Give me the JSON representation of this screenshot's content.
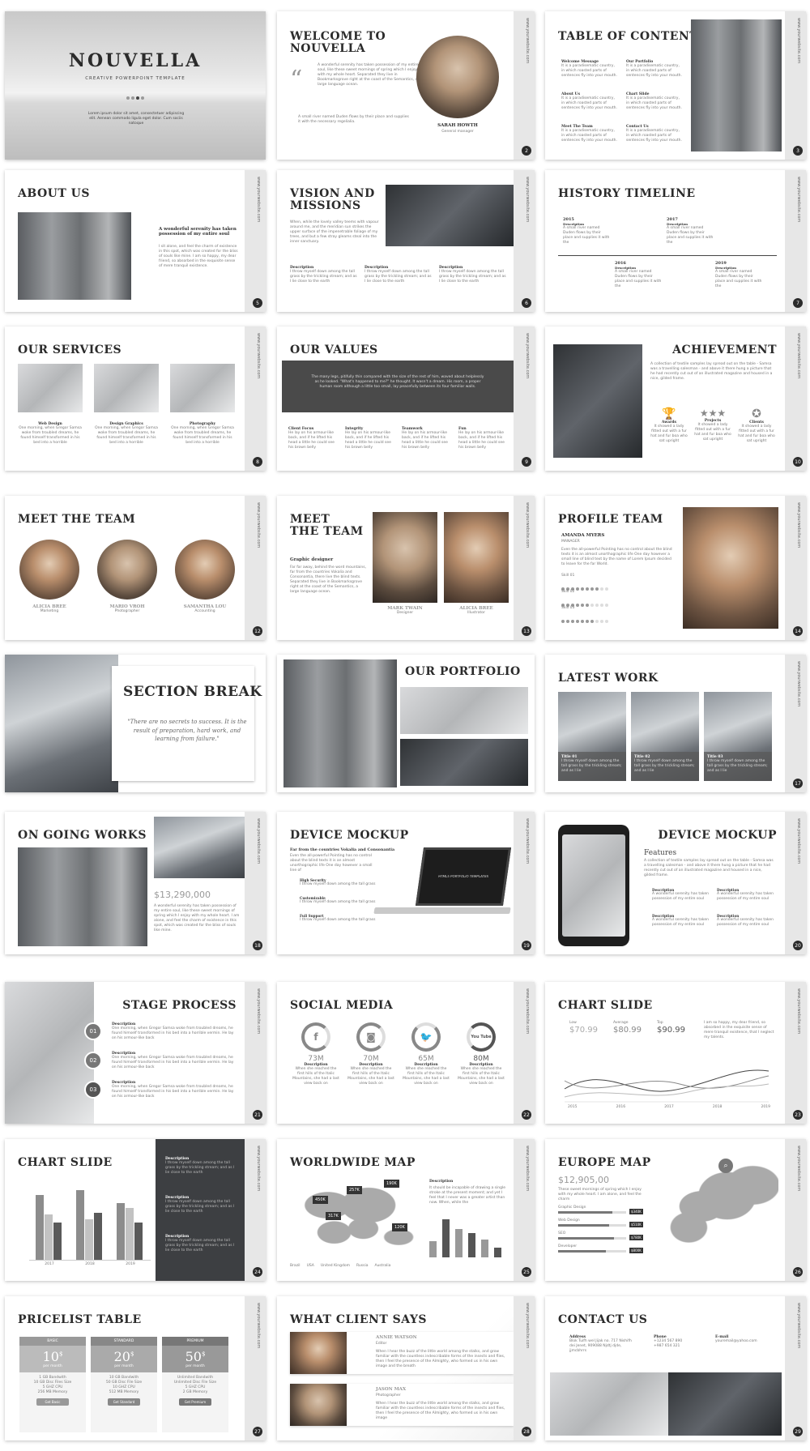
{
  "page": {
    "background": "#ffffff",
    "slide_border": "#e7e7e7",
    "accent": "#2b2b2b"
  },
  "common": {
    "vertical_url": "www.yourwebsite.com",
    "lorem": "It is a paradisematic country, in which roasted parts of sentences fly into your mouth.",
    "lorem_long": "A collection of textile samples lay spread out on the table - Samsa was a travelling salesman - and above it there hung a picture that he had recently cut out of an illustrated magazine and housed in a nice, gilded frame."
  },
  "slides": {
    "s1": {
      "title": "NOUVELLA",
      "subtitle": "CREATIVE POWERPOINT TEMPLATE",
      "desc": "Lorem ipsum dolor sit amet, consectetuer adipiscing elit. Aenean commodo ligula eget dolor. Cum sociis natoque"
    },
    "s2": {
      "title": "WELCOME TO\nNOUVELLA",
      "quote_mark": "“",
      "text1": "A wonderful serenity has taken possession of my entire soul, like these sweet mornings of spring which I enjoy with my whole heart. Separated they live in Bookmarksgrove right at the coast of the Semantics, a large language ocean.",
      "text2": "A small river named Duden flows by their place and supplies it with the necessary regelialia.",
      "name": "SARAH HOWTH",
      "role": "General manager",
      "num": "2"
    },
    "s3": {
      "title": "TABLE OF CONTENT",
      "items": [
        "Welcome Message",
        "Our Portfolio",
        "About Us",
        "Chart Slide",
        "Meet The Team",
        "Contact Us"
      ],
      "num": "3"
    },
    "s4": {
      "title": "ABOUT US",
      "heading": "A wonderful serenity has taken possession of my entire soul",
      "text": "I sit alone, and feel the charm of existence in this spot, which was created for the bliss of souls like mine. I am so happy, my dear friend, so absorbed in the exquisite sense of mere tranquil existence.",
      "num": "5"
    },
    "s5": {
      "title": "VISION AND\nMISSIONS",
      "text": "When, while the lovely valley teems with vapour around me, and the meridian sun strikes the upper surface of the impenetrable foliage of my trees, and but a few stray gleams steal into the inner sanctuary.",
      "cols": [
        {
          "label": "Description",
          "text": "I throw myself down among the tall grass by the trickling stream; and as I lie close to the earth"
        },
        {
          "label": "Description",
          "text": "I throw myself down among the tall grass by the trickling stream; and as I lie close to the earth"
        },
        {
          "label": "Description",
          "text": "I throw myself down among the tall grass by the trickling stream; and as I lie close to the earth"
        }
      ],
      "num": "6"
    },
    "s6": {
      "title": "HISTORY TIMELINE",
      "top": [
        {
          "year": "2015",
          "label": "Description",
          "text": "A small river named Duden flows by their place and supplies it with the"
        },
        {
          "year": "2017",
          "label": "Description",
          "text": "A small river named Duden flows by their place and supplies it with the"
        }
      ],
      "bottom": [
        {
          "year": "2016",
          "label": "Description",
          "text": "A small river named Duden flows by their place and supplies it with the"
        },
        {
          "year": "2019",
          "label": "Description",
          "text": "A small river named Duden flows by their place and supplies it with the"
        }
      ],
      "num": "7"
    },
    "s7": {
      "title": "OUR SERVICES",
      "items": [
        {
          "label": "Web Design",
          "text": "One morning, when Gregor Samsa woke from troubled dreams, he found himself transformed in his bed into a horrible"
        },
        {
          "label": "Design Graphics",
          "text": "One morning, when Gregor Samsa woke from troubled dreams, he found himself transformed in his bed into a horrible"
        },
        {
          "label": "Photography",
          "text": "One morning, when Gregor Samsa woke from troubled dreams, he found himself transformed in his bed into a horrible"
        }
      ],
      "num": "8"
    },
    "s8": {
      "title": "OUR VALUES",
      "banner": "The many legs, pitifully thin compared with the size of the rest of him, waved about helplessly as he looked. \"What's happened to me?\" he thought. It wasn't a dream. His room, a proper human room although a little too small, lay peacefully between its four familiar walls.",
      "items": [
        {
          "label": "Client Focus",
          "text": "He lay on his armour-like back, and if he lifted his head a little he could see his brown belly"
        },
        {
          "label": "Integrity",
          "text": "He lay on his armour-like back, and if he lifted his head a little he could see his brown belly"
        },
        {
          "label": "Teamwork",
          "text": "He lay on his armour-like back, and if he lifted his head a little he could see his brown belly"
        },
        {
          "label": "Fun",
          "text": "He lay on his armour-like back, and if he lifted his head a little he could see his brown belly"
        }
      ],
      "num": "9"
    },
    "s9": {
      "title": "ACHIEVEMENT",
      "items": [
        {
          "label": "Awards",
          "text": "It showed a lady fitted out with a fur hat and fur boa who sat upright"
        },
        {
          "label": "Projects",
          "text": "It showed a lady fitted out with a fur hat and fur boa who sat upright"
        },
        {
          "label": "Clients",
          "text": "It showed a lady fitted out with a fur hat and fur boa who sat upright"
        }
      ],
      "num": "10"
    },
    "s10": {
      "title": "MEET THE TEAM",
      "members": [
        {
          "name": "ALICIA BREE",
          "role": "Marketing"
        },
        {
          "name": "MARIO VROH",
          "role": "Photographer"
        },
        {
          "name": "SAMANTHA LOU",
          "role": "Accounting"
        }
      ],
      "num": "12"
    },
    "s11": {
      "title": "MEET\nTHE TEAM",
      "heading": "Graphic designer",
      "text": "Far far away, behind the word mountains, far from the countries Vokalia and Consonantia, there live the blind texts. Separated they live in Bookmarksgrove right at the coast of the Semantics, a large language ocean.",
      "members": [
        {
          "name": "MARK TWAIN",
          "role": "Designer"
        },
        {
          "name": "ALICIA BREE",
          "role": "Illustrator"
        }
      ],
      "num": "13"
    },
    "s12": {
      "title": "PROFILE TEAM",
      "name": "AMANDA MYERS",
      "role": "MANAGER",
      "text": "Even the all-powerful Pointing has no control about the blind texts it is an almost unorthographic life One day however a small line of blind text by the name of Lorem Ipsum decided to leave for the far World.",
      "skills": [
        {
          "label": "Skill 01",
          "value": 8
        },
        {
          "label": "Skill 02",
          "value": 6
        },
        {
          "label": "Skill 03",
          "value": 7
        }
      ],
      "num": "14"
    },
    "s13": {
      "title": "SECTION BREAK",
      "quote": "\"There are no secrets to success. It is the result of preparation, hard work, and learning from failure.\""
    },
    "s14": {
      "title": "OUR PORTFOLIO"
    },
    "s15": {
      "title": "LATEST WORK",
      "items": [
        {
          "label": "Title 01",
          "text": "I throw myself down among the tall grass by the trickling stream; and as I lie"
        },
        {
          "label": "Title 02",
          "text": "I throw myself down among the tall grass by the trickling stream; and as I lie"
        },
        {
          "label": "Title 03",
          "text": "I throw myself down among the tall grass by the trickling stream; and as I lie"
        }
      ],
      "num": "17"
    },
    "s16": {
      "title": "ON GOING WORKS",
      "amount": "$13,290,000",
      "text": "A wonderful serenity has taken possession of my entire soul, like these sweet mornings of spring which I enjoy with my whole heart. I am alone, and feel the charm of existence in this spot, which was created for the bliss of souls like mine.",
      "num": "18"
    },
    "s17": {
      "title": "DEVICE MOCKUP",
      "heading": "Far from the countries Vokalia and Consonantia",
      "text": "Even the all-powerful Pointing has no control about the blind texts it is an almost unorthographic life One day however a small line of",
      "items": [
        {
          "label": "High Security",
          "text": "I throw myself down among the tall grass"
        },
        {
          "label": "Customizable",
          "text": "I throw myself down among the tall grass"
        },
        {
          "label": "Full Support",
          "text": "I throw myself down among the tall grass"
        }
      ],
      "screen": "HTML5 PORTFOLIO TEMPLATES",
      "num": "19"
    },
    "s18": {
      "title": "DEVICE MOCKUP",
      "features": "Features",
      "text": "A collection of textile samples lay spread out on the table - Samsa was a travelling salesman - and above it there hung a picture that he had recently cut out of an illustrated magazine and housed in a nice, gilded frame.",
      "items": [
        {
          "label": "Description",
          "text": "A wonderful serenity has taken possession of my entire soul"
        },
        {
          "label": "Description",
          "text": "A wonderful serenity has taken possession of my entire soul"
        },
        {
          "label": "Description",
          "text": "A wonderful serenity has taken possession of my entire soul"
        },
        {
          "label": "Description",
          "text": "A wonderful serenity has taken possession of my entire soul"
        }
      ],
      "num": "20"
    },
    "s19": {
      "title": "STAGE PROCESS",
      "steps": [
        {
          "n": "01",
          "label": "Description",
          "text": "One morning, when Gregor Samsa woke from troubled dreams, he found himself transformed in his bed into a horrible vermin. He lay on his armour-like back"
        },
        {
          "n": "02",
          "label": "Description",
          "text": "One morning, when Gregor Samsa woke from troubled dreams, he found himself transformed in his bed into a horrible vermin. He lay on his armour-like back"
        },
        {
          "n": "03",
          "label": "Description",
          "text": "One morning, when Gregor Samsa woke from troubled dreams, he found himself transformed in his bed into a horrible vermin. He lay on his armour-like back"
        }
      ],
      "num": "21"
    },
    "s20": {
      "title": "SOCIAL MEDIA",
      "items": [
        {
          "icon": "f",
          "value": "73M",
          "fill": 0.73,
          "label": "Description",
          "text": "When she reached the first hills of the Italic Mountains, she had a last view back on"
        },
        {
          "icon": "◙",
          "value": "70M",
          "fill": 0.7,
          "label": "Description",
          "text": "When she reached the first hills of the Italic Mountains, she had a last view back on"
        },
        {
          "icon": "🐦",
          "value": "65M",
          "fill": 0.65,
          "label": "Description",
          "text": "When she reached the first hills of the Italic Mountains, she had a last view back on"
        },
        {
          "icon": "You Tube",
          "value": "80M",
          "fill": 0.8,
          "label": "Description",
          "text": "When she reached the first hills of the Italic Mountains, she had a last view back on"
        }
      ],
      "num": "22"
    },
    "s21": {
      "title": "CHART SLIDE",
      "stats": [
        {
          "label": "Low",
          "value": "$70.99"
        },
        {
          "label": "Average",
          "value": "$80.99"
        },
        {
          "label": "Top",
          "value": "$90.99"
        }
      ],
      "text": "I am so happy, my dear friend, so absorbed in the exquisite sense of mere tranquil existence, that I neglect my talents.",
      "x_labels": [
        "2015",
        "2016",
        "2017",
        "2018",
        "2019"
      ],
      "num": "23"
    },
    "s22": {
      "title": "CHART SLIDE",
      "x_labels": [
        "2017",
        "2018",
        "2019"
      ],
      "y_labels": [
        "0",
        "10",
        "20",
        "30",
        "40",
        "50",
        "60",
        "70",
        "80",
        "90",
        "100"
      ],
      "series": [
        [
          80,
          86,
          70
        ],
        [
          56,
          50,
          64
        ],
        [
          46,
          58,
          46
        ]
      ],
      "items": [
        {
          "label": "Description",
          "text": "I throw myself down among the tall grass by the trickling stream; and as I lie close to the earth"
        },
        {
          "label": "Description",
          "text": "I throw myself down among the tall grass by the trickling stream; and as I lie close to the earth"
        },
        {
          "label": "Description",
          "text": "I throw myself down among the tall grass by the trickling stream; and as I lie close to the earth"
        }
      ],
      "num": "24"
    },
    "s23": {
      "title": "WORLDWIDE MAP",
      "callouts": [
        "190K",
        "257K",
        "450K",
        "317K",
        "120K"
      ],
      "desc_label": "Description",
      "desc_text": "It should be incapable of drawing a single stroke at the present moment; and yet I feel that I never was a greater artist than now. When, while the",
      "legend": [
        "Brazil",
        "USA",
        "United Kingdom",
        "Russia",
        "Australia"
      ],
      "bars": [
        40,
        95,
        70,
        60,
        45,
        25
      ],
      "num": "25"
    },
    "s24": {
      "title": "EUROPE MAP",
      "amount": "$12,905,00",
      "text": "These sweet mornings of spring which I enjoy with my whole heart. I am alone, and feel the charm",
      "bars": [
        {
          "label": "Graphic Design",
          "value": "$340K",
          "fill": 0.8
        },
        {
          "label": "Web Design",
          "value": "$510K",
          "fill": 0.75
        },
        {
          "label": "SEO",
          "value": "$780K",
          "fill": 0.82
        },
        {
          "label": "Developer",
          "value": "$800K",
          "fill": 0.7
        }
      ],
      "num": "26"
    },
    "s25": {
      "title": "PRICELIST TABLE",
      "plans": [
        {
          "name": "BASIC",
          "price": "10",
          "cur": "$",
          "per": "per month",
          "f": [
            "1 GB Bandwith",
            "10 GB Disc Files Size",
            "5 GHZ CPU",
            "256 MB Memory"
          ],
          "btn": "Get Basic"
        },
        {
          "name": "STANDARD",
          "price": "20",
          "cur": "$",
          "per": "per month",
          "f": [
            "10 GB Bandwith",
            "50 GB Disc File Size",
            "10 GHZ CPU",
            "512 MB Memory"
          ],
          "btn": "Get Standard"
        },
        {
          "name": "PREMIUM",
          "price": "50",
          "cur": "$",
          "per": "per month",
          "f": [
            "Unlimited Bandwith",
            "Unlimited Disc File Size",
            "5 GHZ CPU",
            "2 GB Memory"
          ],
          "btn": "Get Premium"
        }
      ],
      "num": "27"
    },
    "s26": {
      "title": "WHAT CLIENT SAYS",
      "clients": [
        {
          "name": "ANNIE WATSON",
          "role": "Editor",
          "text": "When I hear the buzz of the little world among the stalks, and grow familiar with the countless indescribable forms of the insects and flies, then I feel the presence of the Almighty, who formed us in his own image and the breath"
        },
        {
          "name": "JASON MAX",
          "role": "Photographer",
          "text": "When I hear the buzz of the little world among the stalks, and grow familiar with the countless indescribable forms of the insects and flies, then I feel the presence of the Almighty, who formed us in his own image"
        }
      ],
      "num": "28"
    },
    "s27": {
      "title": "CONTACT US",
      "address_label": "Address",
      "address": "Blok Tuifh wel Jijak no. 717 Nishifh dei Jenet, 909088 Njdtj djde, jjmcbhrrs",
      "phone_label": "Phone",
      "phone": "+1234 567 890\n+987 654 321",
      "email_label": "E-mail",
      "email": "youremail@yahoo.com",
      "num": "29"
    }
  }
}
